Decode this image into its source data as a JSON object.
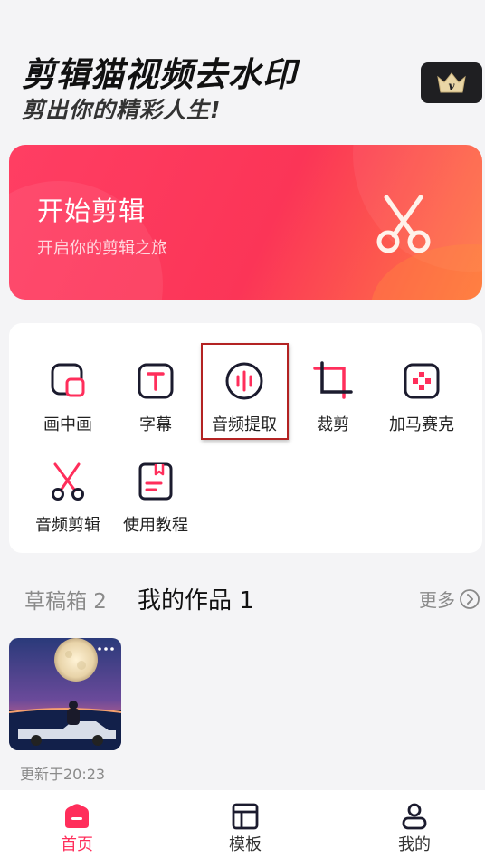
{
  "header": {
    "title": "剪辑猫视频去水印",
    "subtitle": "剪出你的精彩人生!",
    "vip_icon": "crown-icon"
  },
  "banner": {
    "title": "开始剪辑",
    "subtitle": "开启你的剪辑之旅",
    "icon": "scissors-icon"
  },
  "tools": [
    {
      "label": "画中画",
      "icon": "picture-in-picture-icon"
    },
    {
      "label": "字幕",
      "icon": "subtitle-icon"
    },
    {
      "label": "音频提取",
      "icon": "audio-extract-icon",
      "highlighted": true
    },
    {
      "label": "裁剪",
      "icon": "crop-icon"
    },
    {
      "label": "加马赛克",
      "icon": "mosaic-icon"
    },
    {
      "label": "音频剪辑",
      "icon": "audio-cut-icon"
    },
    {
      "label": "使用教程",
      "icon": "tutorial-icon"
    }
  ],
  "tabs": {
    "drafts": "草稿箱 2",
    "works": "我的作品 1",
    "more": "更多"
  },
  "works": [
    {
      "updated": "更新于20:23"
    }
  ],
  "nav": [
    {
      "label": "首页",
      "icon": "home-icon",
      "active": true
    },
    {
      "label": "模板",
      "icon": "template-icon",
      "active": false
    },
    {
      "label": "我的",
      "icon": "profile-icon",
      "active": false
    }
  ],
  "colors": {
    "accent": "#ff2e5b",
    "text_dark": "#111111",
    "text_gray": "#8a8a8a"
  }
}
